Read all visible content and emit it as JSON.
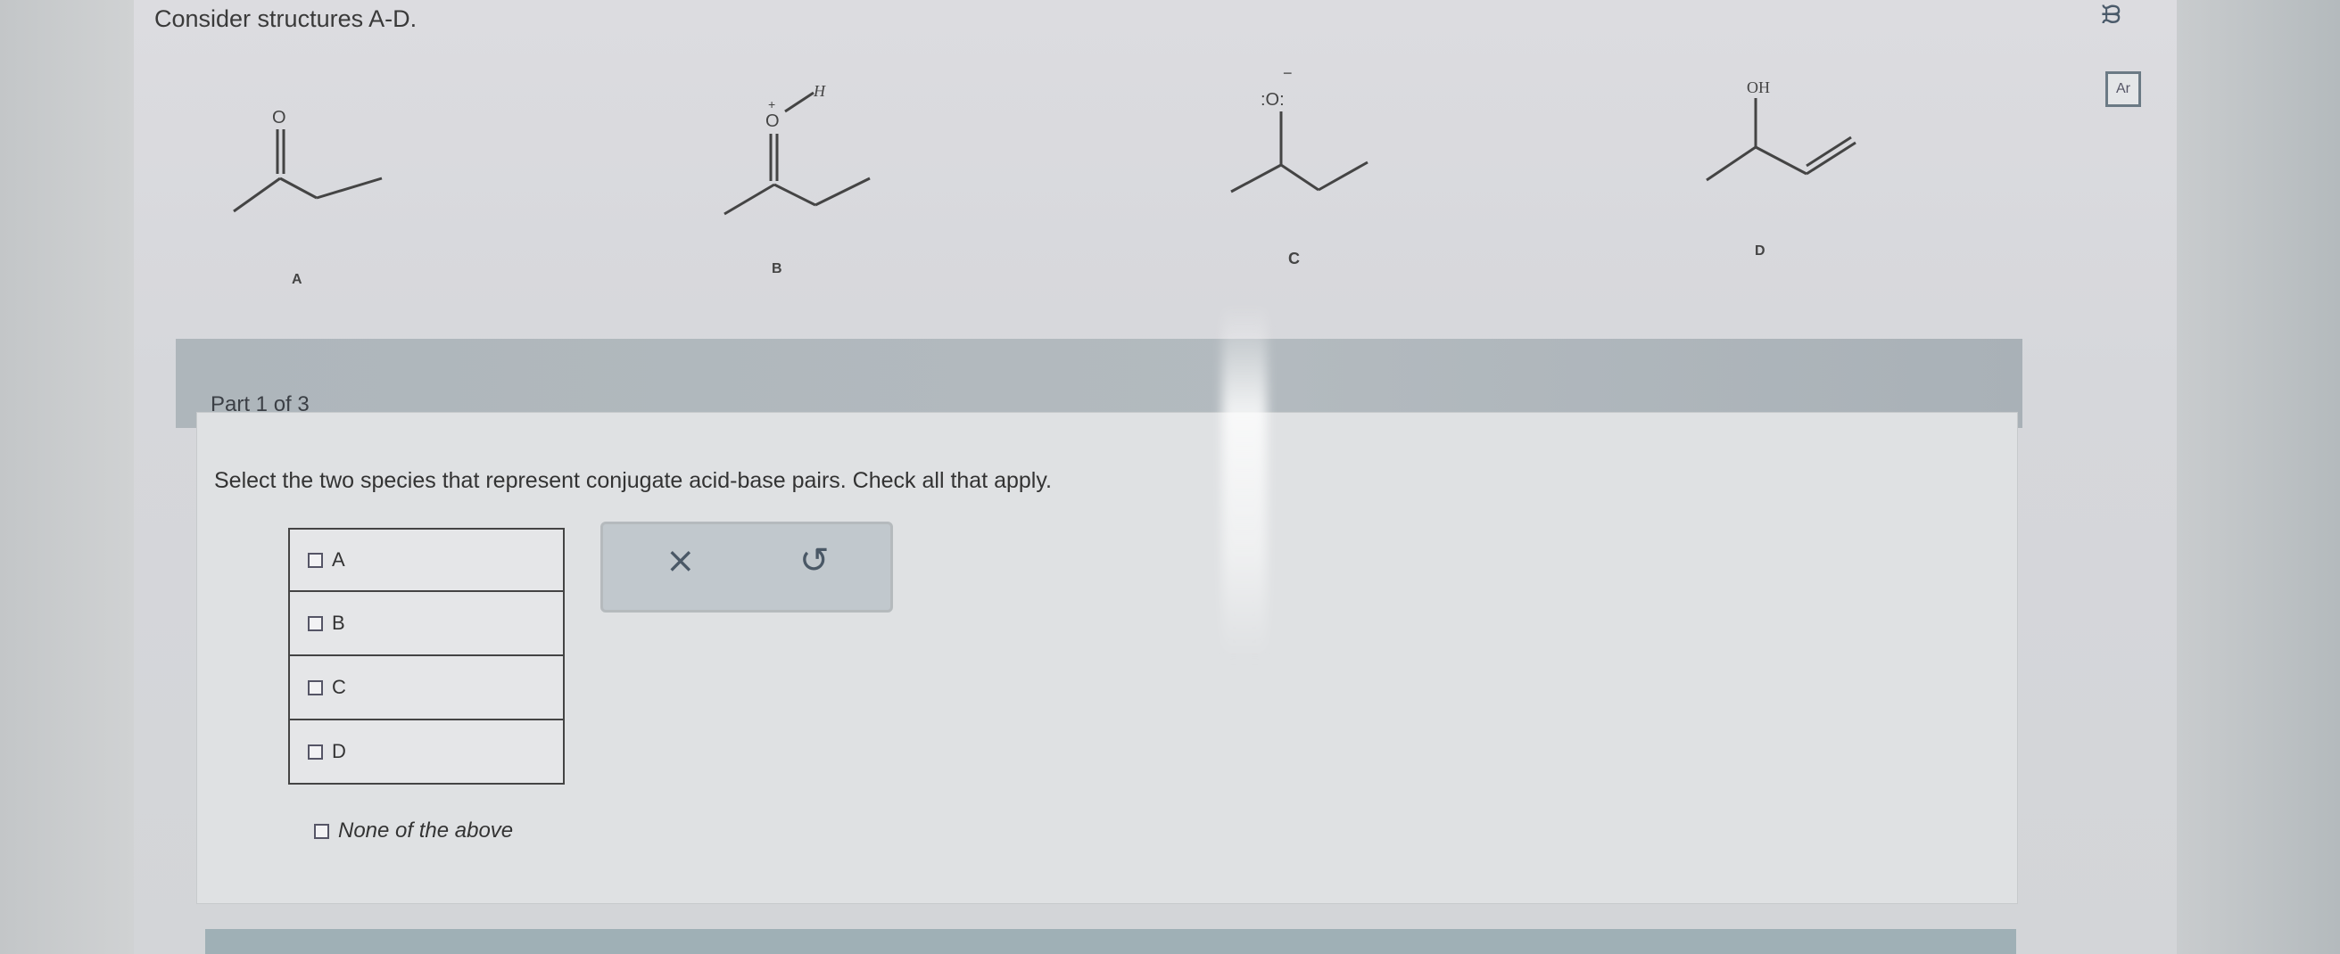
{
  "header": {
    "prompt": "Consider structures A-D."
  },
  "tools": {
    "chart_icon": "chart-icon",
    "periodic_icon": "periodic-table-icon"
  },
  "structures": {
    "A": {
      "label": "A",
      "atom": "O"
    },
    "B": {
      "label": "B",
      "atom": "O",
      "h": "H",
      "charge": "+"
    },
    "C": {
      "label": "C",
      "atom": ":O:",
      "charge": "−"
    },
    "D": {
      "label": "D",
      "atom": "OH"
    }
  },
  "part": {
    "label": "Part 1 of 3"
  },
  "question": {
    "text": "Select the two species that represent conjugate acid-base pairs. Check all that apply."
  },
  "options": [
    {
      "label": "A",
      "checked": false
    },
    {
      "label": "B",
      "checked": false
    },
    {
      "label": "C",
      "checked": false
    },
    {
      "label": "D",
      "checked": false
    }
  ],
  "none_option": {
    "label": "None of the above",
    "checked": false
  },
  "actions": {
    "clear_glyph": "×",
    "undo_glyph": "↺"
  }
}
